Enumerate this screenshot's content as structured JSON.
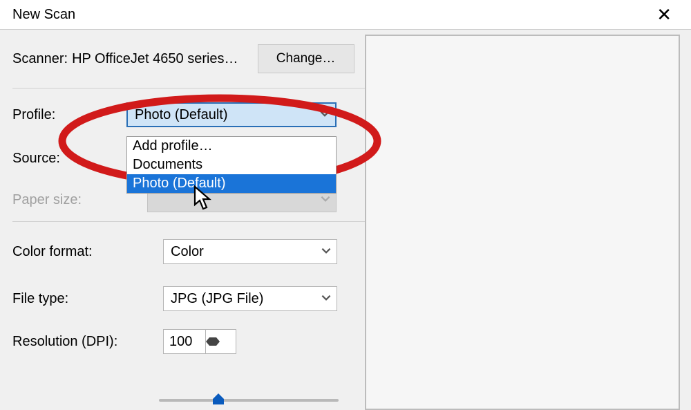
{
  "window": {
    "title": "New Scan",
    "close_glyph": "✕"
  },
  "scanner": {
    "label": "Scanner:",
    "device": "HP OfficeJet 4650 series…",
    "change_btn": "Change…"
  },
  "profile": {
    "label": "Profile:",
    "selected": "Photo (Default)",
    "options": {
      "add": "Add profile…",
      "documents": "Documents",
      "photo": "Photo (Default)"
    }
  },
  "source": {
    "label": "Source:"
  },
  "paper_size": {
    "label": "Paper size:"
  },
  "color_format": {
    "label": "Color format:",
    "value": "Color"
  },
  "file_type": {
    "label": "File type:",
    "value": "JPG (JPG File)"
  },
  "resolution": {
    "label": "Resolution (DPI):",
    "value": "100"
  },
  "colors": {
    "annotation": "#d11a1a",
    "highlight_bg": "#1a74d8",
    "thumb": "#0a5bbd"
  }
}
